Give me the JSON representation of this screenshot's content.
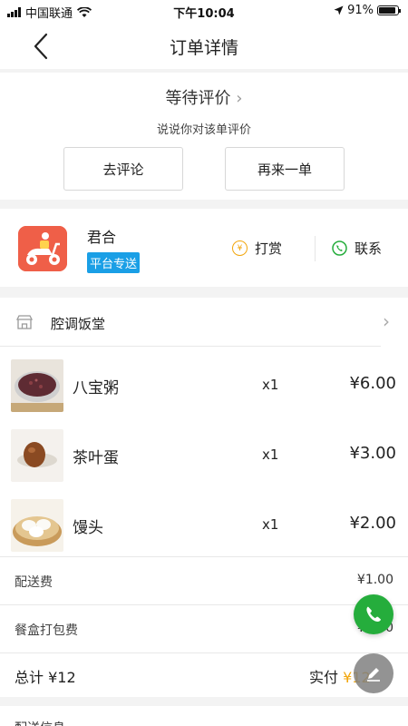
{
  "status_bar": {
    "carrier": "中国联通",
    "time": "下午10:04",
    "battery": "91%",
    "battery_level": 0.91
  },
  "nav": {
    "title": "订单详情"
  },
  "evaluation": {
    "status": "等待评价",
    "subtitle": "说说你对该单评价",
    "review_button": "去评论",
    "reorder_button": "再来一单"
  },
  "rider": {
    "name": "君合",
    "badge": "平台专送",
    "tip_label": "打赏",
    "contact_label": "联系",
    "tip_symbol": "¥"
  },
  "shop": {
    "name": "腔调饭堂"
  },
  "items": [
    {
      "name": "八宝粥",
      "qty": "x1",
      "price": "¥6.00"
    },
    {
      "name": "茶叶蛋",
      "qty": "x1",
      "price": "¥3.00"
    },
    {
      "name": "馒头",
      "qty": "x1",
      "price": "¥2.00"
    }
  ],
  "fees": [
    {
      "label": "配送费",
      "value": "¥1.00"
    },
    {
      "label": "餐盒打包费",
      "value": "¥0.00"
    }
  ],
  "total": {
    "label": "总计 ¥12",
    "paid_label": "实付 ",
    "paid_value": "¥12"
  },
  "next_section": {
    "label": "配送信息"
  },
  "colors": {
    "accent_orange": "#f2a60c",
    "badge_blue": "#1a9fe6",
    "phone_green": "#25ad3c",
    "rider_red": "#ef5f48"
  }
}
